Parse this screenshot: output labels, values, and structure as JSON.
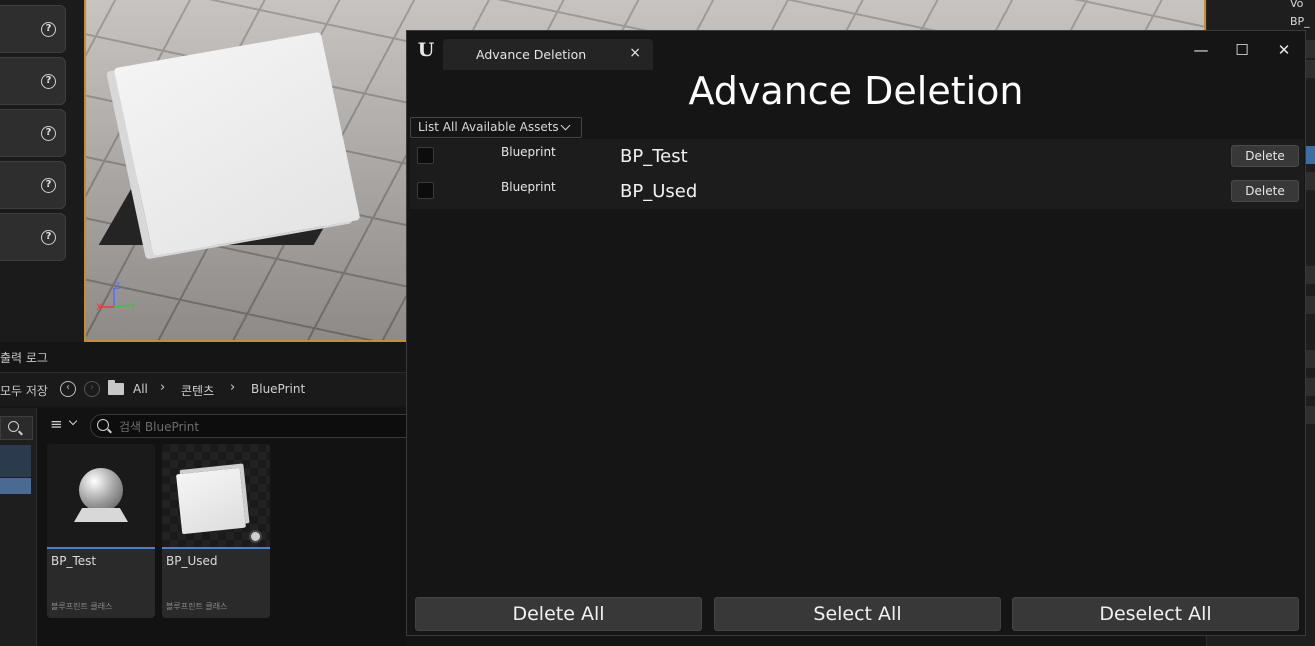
{
  "window": {
    "tab_title": "Advance Deletion",
    "tab_close": "×",
    "minimize": "—",
    "maximize": "☐",
    "close": "✕",
    "heading": "Advance Deletion",
    "filter_combo": "List All Available Assets",
    "assets": [
      {
        "class": "Blueprint",
        "name": "BP_Test",
        "delete_label": "Delete"
      },
      {
        "class": "Blueprint",
        "name": "BP_Used",
        "delete_label": "Delete"
      }
    ],
    "buttons": {
      "delete_all": "Delete All",
      "select_all": "Select All",
      "deselect_all": "Deselect All"
    }
  },
  "details_panel": {
    "help_glyph": "?"
  },
  "viewport": {
    "axis_z": "Z",
    "axis_x": "X",
    "axis_y": "Y"
  },
  "content_browser": {
    "output_log_tab": "출력 로그",
    "save_all": "모두 저장",
    "breadcrumb": [
      "All",
      "콘텐츠",
      "BluePrint"
    ],
    "search_placeholder": "검색 BluePrint",
    "assets": [
      {
        "name": "BP_Test",
        "class": "블루프린트 클래스"
      },
      {
        "name": "BP_Used",
        "class": "블루프린트 클래스"
      }
    ]
  },
  "right_panel": {
    "top_text_1": "Vo",
    "top_text_2": "BP_"
  },
  "colors": {
    "viewport_border": "#c88e2e",
    "selection_blue": "#4c7fcf"
  },
  "icons": [
    "unreal-logo-icon",
    "help-icon",
    "back-arrow-icon",
    "forward-arrow-icon",
    "folder-icon",
    "filter-icon",
    "search-icon",
    "chevron-down-icon"
  ]
}
